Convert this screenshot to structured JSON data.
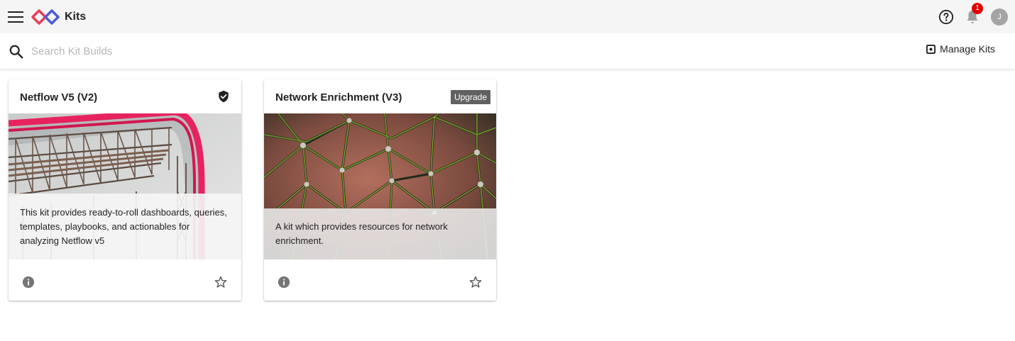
{
  "header": {
    "title": "Kits",
    "notification_count": "1",
    "avatar_initial": "J"
  },
  "search": {
    "placeholder": "Search Kit Builds",
    "value": ""
  },
  "toolbar": {
    "manage_label": "Manage Kits"
  },
  "kits": [
    {
      "title": "Netflow V5 (V2)",
      "description": "This kit provides ready-to-roll dashboards, queries, templates, playbooks, and actionables for analyzing Netflow v5",
      "status_icon": "verified-shield-icon"
    },
    {
      "title": "Network Enrichment (V3)",
      "description": "A kit which provides resources for network enrichment.",
      "badge": "Upgrade"
    }
  ],
  "colors": {
    "logo_red": "#e53e57",
    "logo_blue": "#4b5bd6",
    "badge_red": "#e00000",
    "upgrade_badge": "#616161"
  }
}
